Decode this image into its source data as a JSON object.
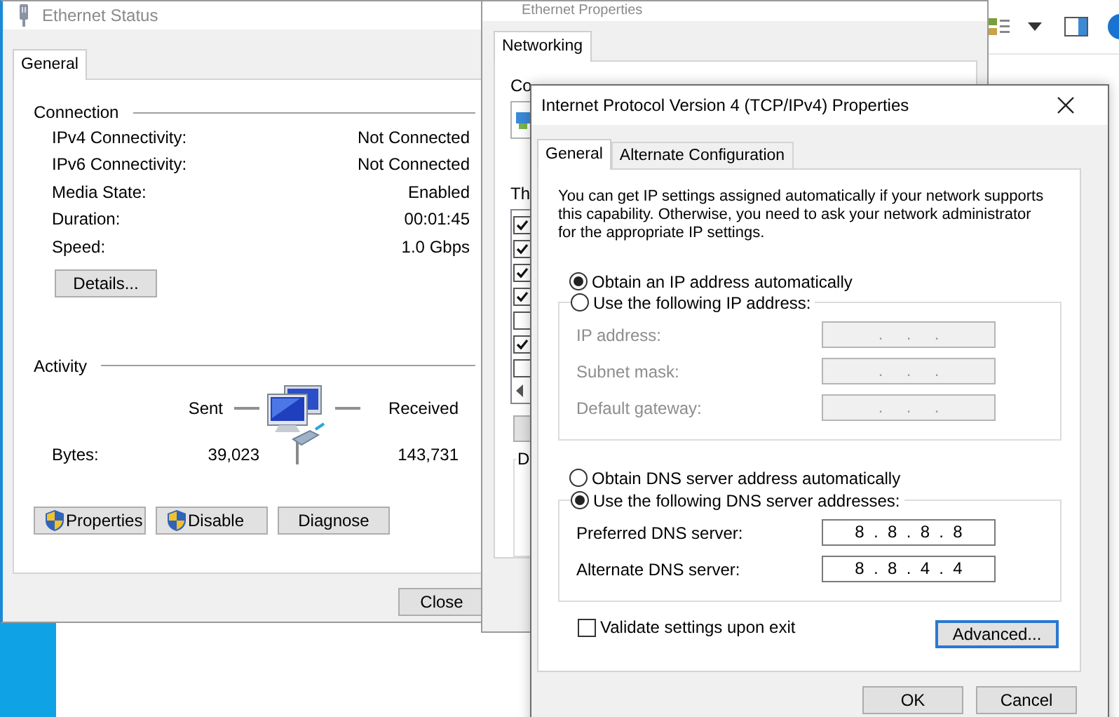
{
  "ethernet_status": {
    "title": "Ethernet Status",
    "tabs": [
      {
        "label": "General",
        "selected": true
      }
    ],
    "connection": {
      "heading": "Connection",
      "rows": [
        {
          "label": "IPv4 Connectivity:",
          "value": "Not Connected"
        },
        {
          "label": "IPv6 Connectivity:",
          "value": "Not Connected"
        },
        {
          "label": "Media State:",
          "value": "Enabled"
        },
        {
          "label": "Duration:",
          "value": "00:01:45"
        },
        {
          "label": "Speed:",
          "value": "1.0 Gbps"
        }
      ]
    },
    "details_button": "Details...",
    "activity": {
      "heading": "Activity",
      "sent_label": "Sent",
      "received_label": "Received",
      "bytes_label": "Bytes:",
      "sent": "39,023",
      "received": "143,731"
    },
    "buttons": [
      {
        "label": "Properties",
        "kind": "shield"
      },
      {
        "label": "Disable",
        "kind": "shield"
      },
      {
        "label": "Diagnose",
        "kind": "plain"
      }
    ],
    "close_button": "Close"
  },
  "ethernet_properties": {
    "title": "Ethernet Properties",
    "tabs": [
      {
        "label": "Networking",
        "selected": true
      }
    ],
    "connect_label": "Co",
    "items_label": "Th",
    "items": [
      {
        "checked": true
      },
      {
        "checked": true
      },
      {
        "checked": true
      },
      {
        "checked": true
      },
      {
        "checked": false
      },
      {
        "checked": true
      },
      {
        "checked": false
      }
    ],
    "group_label": "D"
  },
  "ipv4_dialog": {
    "title": "Internet Protocol Version 4 (TCP/IPv4) Properties",
    "tabs": [
      {
        "label": "General",
        "selected": true
      },
      {
        "label": "Alternate Configuration",
        "selected": false
      }
    ],
    "intro": "You can get IP settings assigned automatically if your network supports this capability. Otherwise, you need to ask your network administrator for the appropriate IP settings.",
    "ip_options": [
      {
        "label": "Obtain an IP address automatically",
        "selected": true
      },
      {
        "label": "Use the following IP address:",
        "selected": false
      }
    ],
    "ip_fields": [
      {
        "label": "IP address:",
        "value": ".     .     .",
        "disabled": true
      },
      {
        "label": "Subnet mask:",
        "value": ".     .     .",
        "disabled": true
      },
      {
        "label": "Default gateway:",
        "value": ".     .     .",
        "disabled": true
      }
    ],
    "dns_options": [
      {
        "label": "Obtain DNS server address automatically",
        "selected": false
      },
      {
        "label": "Use the following DNS server addresses:",
        "selected": true
      }
    ],
    "dns_fields": [
      {
        "label": "Preferred DNS server:",
        "value": "8  .  8  .  8  .  8",
        "disabled": false
      },
      {
        "label": "Alternate DNS server:",
        "value": "8  .  8  .  4  .  4",
        "disabled": false
      }
    ],
    "validate": {
      "label": "Validate settings upon exit",
      "checked": false
    },
    "advanced_button": "Advanced...",
    "ok_button": "OK",
    "cancel_button": "Cancel"
  }
}
